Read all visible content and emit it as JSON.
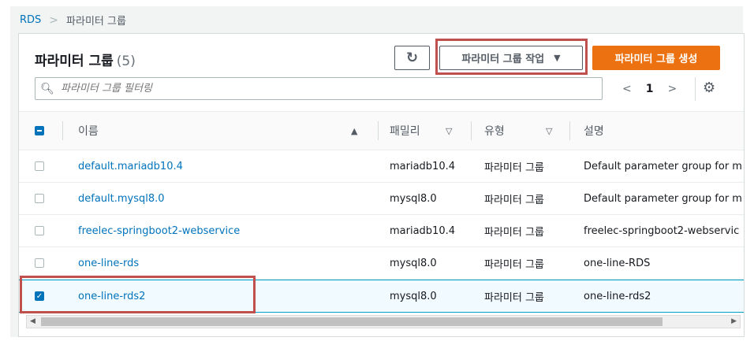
{
  "breadcrumb": {
    "root": "RDS",
    "current": "파라미터 그룹"
  },
  "header": {
    "title": "파라미터 그룹",
    "count": "(5)"
  },
  "toolbar": {
    "refresh_icon": "↻",
    "actions_label": "파라미터 그룹 작업",
    "actions_caret": "▼",
    "create_label": "파라미터 그룹 생성"
  },
  "search": {
    "placeholder": "파라미터 그룹 필터링"
  },
  "pagination": {
    "prev": "<",
    "page": "1",
    "next": ">"
  },
  "settings_icon": "⚙",
  "table": {
    "columns": [
      "이름",
      "패밀리",
      "유형",
      "설명"
    ],
    "sort_asc": "▲",
    "sort_none": "▽",
    "rows": [
      {
        "name": "default.mariadb10.4",
        "family": "mariadb10.4",
        "type": "파라미터 그룹",
        "description": "Default parameter group for m",
        "selected": false
      },
      {
        "name": "default.mysql8.0",
        "family": "mysql8.0",
        "type": "파라미터 그룹",
        "description": "Default parameter group for m",
        "selected": false
      },
      {
        "name": "freelec-springboot2-webservice",
        "family": "mariadb10.4",
        "type": "파라미터 그룹",
        "description": "freelec-springboot2-webservic",
        "selected": false
      },
      {
        "name": "one-line-rds",
        "family": "mysql8.0",
        "type": "파라미터 그룹",
        "description": "one-line-RDS",
        "selected": false
      },
      {
        "name": "one-line-rds2",
        "family": "mysql8.0",
        "type": "파라미터 그룹",
        "description": "one-line-rds2",
        "selected": true
      }
    ]
  },
  "scrollbar": {
    "left": "◀",
    "right": "▶"
  },
  "colors": {
    "accent": "#0073bb",
    "primary_button": "#ec7211",
    "highlight": "#c0504d"
  }
}
